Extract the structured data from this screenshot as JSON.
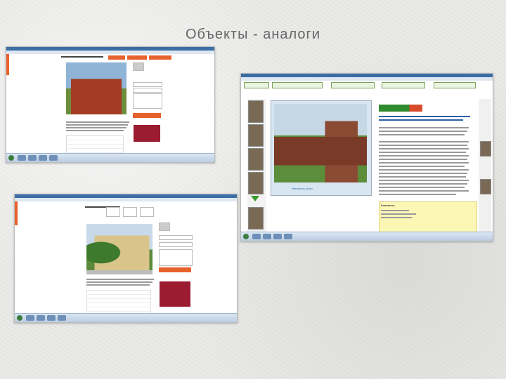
{
  "slide": {
    "title": "Объекты - аналоги"
  },
  "right_screenshot": {
    "photo_caption": "Увеличить фото",
    "contacts_label": "Контакты:"
  },
  "colors": {
    "accent_orange": "#e8622d",
    "price_red": "#9b1b30",
    "yellow_box": "#fdf7b6",
    "taskbar_blue": "#bccde2"
  }
}
